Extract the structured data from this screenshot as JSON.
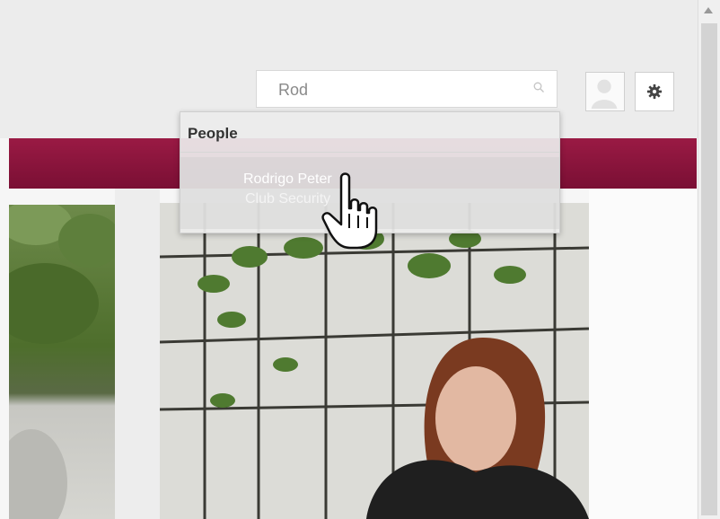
{
  "search": {
    "value": "Rod",
    "icon": "search-icon"
  },
  "header": {
    "avatar_icon": "user-avatar-icon",
    "settings_icon": "gear-icon"
  },
  "dropdown": {
    "section_title": "People",
    "results": [
      {
        "name": "Rodrigo Peter",
        "subtitle": "Club Security"
      }
    ]
  },
  "colors": {
    "banner": "#8b1538",
    "topbar": "#ececec"
  }
}
